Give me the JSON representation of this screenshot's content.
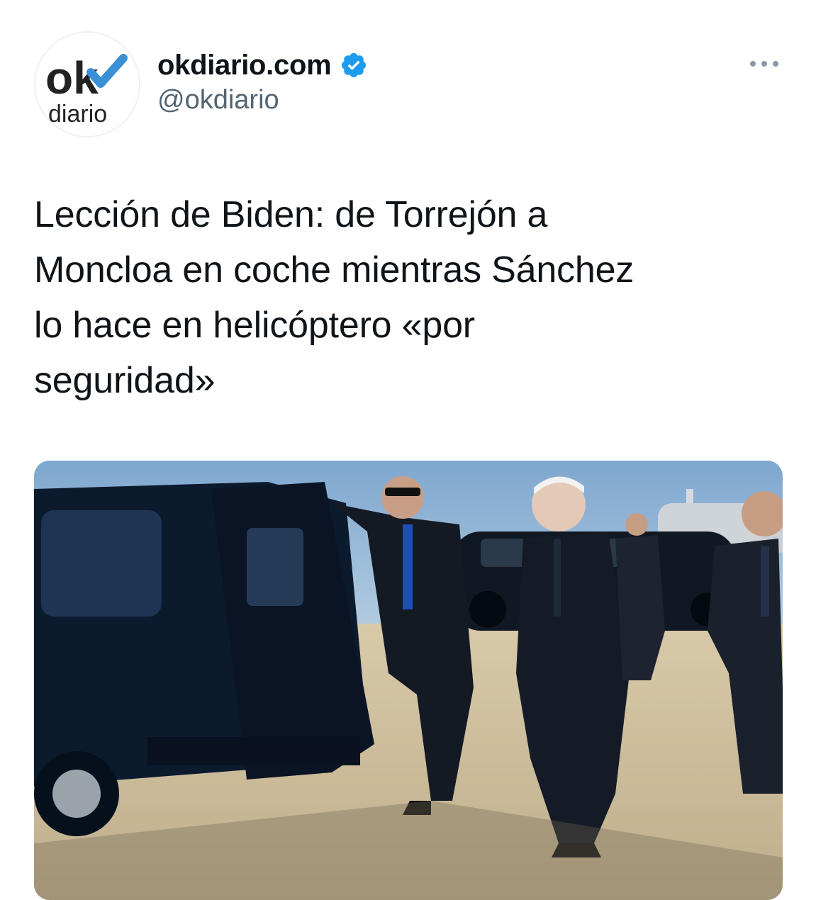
{
  "tweet": {
    "author": {
      "display_name": "okdiario.com",
      "handle": "@okdiario",
      "verified": true,
      "avatar_logo": {
        "top_text": "ok",
        "bottom_text": "diario",
        "check_color": "#3a8fd6",
        "text_color": "#222222"
      }
    },
    "more_icon": "more-horizontal-icon",
    "text": "Lección de Biden: de Torrejón a Moncloa en coche mientras Sánchez lo hace en helicóptero «por seguridad»",
    "text_lines": [
      "Lección de Biden: de Torrejón a",
      "Moncloa en coche mientras Sánchez",
      "lo hace en helicóptero «por",
      "seguridad»"
    ],
    "media": {
      "kind": "photo",
      "subject": "men in suits beside a black SUV on an airport tarmac"
    }
  },
  "colors": {
    "verified_blue": "#1d9bf0",
    "secondary_text": "#536471",
    "primary_text": "#0f1419"
  }
}
